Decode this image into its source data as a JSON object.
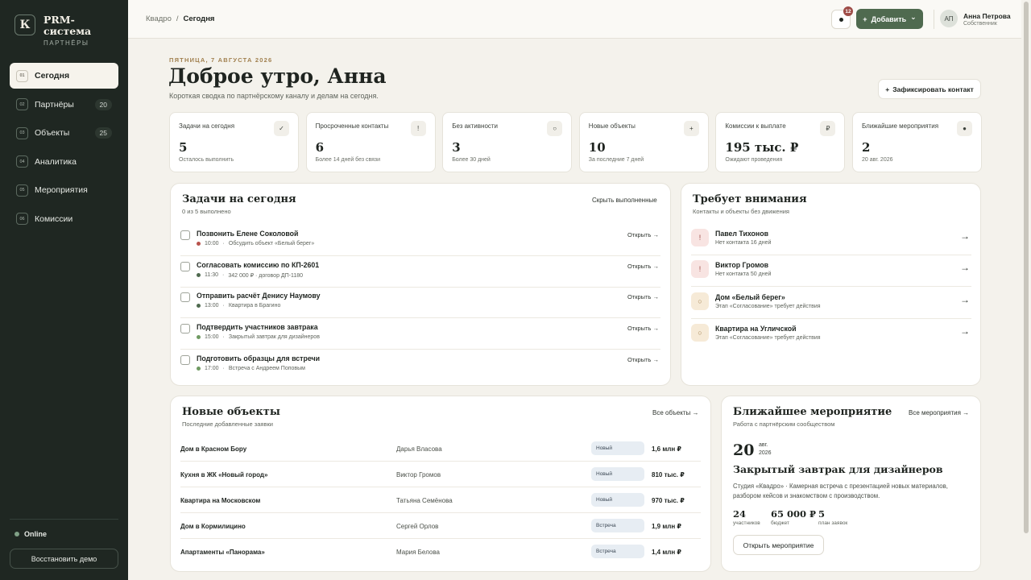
{
  "sidebar": {
    "brand_letter": "К",
    "brand_title": "PRM-система",
    "brand_sub": "ПАРТНЁРЫ",
    "items": [
      {
        "num": "01",
        "label": "Сегодня",
        "badge": ""
      },
      {
        "num": "02",
        "label": "Партнёры",
        "badge": "20"
      },
      {
        "num": "03",
        "label": "Объекты",
        "badge": "25"
      },
      {
        "num": "04",
        "label": "Аналитика",
        "badge": ""
      },
      {
        "num": "05",
        "label": "Мероприятия",
        "badge": ""
      },
      {
        "num": "06",
        "label": "Комиссии",
        "badge": ""
      }
    ],
    "online": "Online",
    "restore": "Восстановить демо"
  },
  "topbar": {
    "crumb_root": "Квадро",
    "crumb_sep": "/",
    "crumb_current": "Сегодня",
    "notif_count": "12",
    "add_label": "Добавить",
    "add_plus": "+",
    "add_chevron": "⌄",
    "user_initials": "АП",
    "user_name": "Анна Петрова",
    "user_role": "Собственник"
  },
  "header": {
    "date": "ПЯТНИЦА, 7 АВГУСТА 2026",
    "greeting": "Доброе утро, Анна",
    "subtitle": "Короткая сводка по партнёрскому каналу и делам на сегодня.",
    "fix_button": "Зафиксировать контакт",
    "fix_plus": "+"
  },
  "kpis": [
    {
      "label": "Задачи на сегодня",
      "icon": "✓",
      "value": "5",
      "note": "Осталось выполнить"
    },
    {
      "label": "Просроченные контакты",
      "icon": "!",
      "value": "6",
      "note": "Более 14 дней без связи"
    },
    {
      "label": "Без активности",
      "icon": "○",
      "value": "3",
      "note": "Более 30 дней"
    },
    {
      "label": "Новые объекты",
      "icon": "+",
      "value": "10",
      "note": "За последние 7 дней"
    },
    {
      "label": "Комиссии к выплате",
      "icon": "₽",
      "value": "195 тыс. ₽",
      "note": "Ожидают проведения"
    },
    {
      "label": "Ближайшие мероприятия",
      "icon": "●",
      "value": "2",
      "note": "20 авг. 2026"
    }
  ],
  "tasks": {
    "title": "Задачи на сегодня",
    "sub": "0 из 5 выполнено",
    "hide_link": "Скрыть выполненные",
    "open_label": "Открыть →",
    "items": [
      {
        "title": "Позвонить Елене Соколовой",
        "time": "10:00",
        "sep": "·",
        "desc": "Обсудить объект «Белый берег»",
        "dot": "#b8534c"
      },
      {
        "title": "Согласовать комиссию по КП-2601",
        "time": "11:30",
        "sep": "·",
        "desc": "342 000 ₽ · договор ДП-1180",
        "dot": "#4f6a4f"
      },
      {
        "title": "Отправить расчёт Денису Наумову",
        "time": "13:00",
        "sep": "·",
        "desc": "Квартира в Брагино",
        "dot": "#4f6a4f"
      },
      {
        "title": "Подтвердить участников завтрака",
        "time": "15:00",
        "sep": "·",
        "desc": "Закрытый завтрак для дизайнеров",
        "dot": "#6f9a62"
      },
      {
        "title": "Подготовить образцы для встречи",
        "time": "17:00",
        "sep": "·",
        "desc": "Встреча с Андреем Поповым",
        "dot": "#6f9a62"
      }
    ]
  },
  "attention": {
    "title": "Требует внимания",
    "sub": "Контакты и объекты без движения",
    "items": [
      {
        "icon": "!",
        "title": "Павел Тихонов",
        "sub": "Нет контакта 16 дней",
        "bg": "#f8e4e2",
        "fg": "#9e4b46"
      },
      {
        "icon": "!",
        "title": "Виктор Громов",
        "sub": "Нет контакта 50 дней",
        "bg": "#f8e4e2",
        "fg": "#9e4b46"
      },
      {
        "icon": "○",
        "title": "Дом «Белый берег»",
        "sub": "Этап «Согласование» требует действия",
        "bg": "#f6ead7",
        "fg": "#a1804f"
      },
      {
        "icon": "○",
        "title": "Квартира на Угличской",
        "sub": "Этап «Согласование» требует действия",
        "bg": "#f6ead7",
        "fg": "#a1804f"
      }
    ],
    "arrow": "→"
  },
  "objects": {
    "title": "Новые объекты",
    "sub": "Последние добавленные заявки",
    "all_link": "Все объекты →",
    "rows": [
      {
        "name": "Дом в Красном Бору",
        "person": "Дарья Власова",
        "status": "Новый",
        "price": "1,6 млн ₽"
      },
      {
        "name": "Кухня в ЖК «Новый город»",
        "person": "Виктор Громов",
        "status": "Новый",
        "price": "810 тыс. ₽"
      },
      {
        "name": "Квартира на Московском",
        "person": "Татьяна Семёнова",
        "status": "Новый",
        "price": "970 тыс. ₽"
      },
      {
        "name": "Дом в Кормилицино",
        "person": "Сергей Орлов",
        "status": "Встреча",
        "price": "1,9 млн ₽"
      },
      {
        "name": "Апартаменты «Панорама»",
        "person": "Мария Белова",
        "status": "Встреча",
        "price": "1,4 млн ₽"
      }
    ]
  },
  "event": {
    "title": "Ближайшее мероприятие",
    "sub": "Работа с партнёрским сообществом",
    "all_link": "Все мероприятия →",
    "day": "20",
    "month": "авг.",
    "year": "2026",
    "name": "Закрытый завтрак для дизайнеров",
    "desc": "Студия «Квадро» · Камерная встреча с презентацией новых материалов, разбором кейсов и знакомством с производством.",
    "stats": [
      {
        "value": "24",
        "label": "участников"
      },
      {
        "value": "65 000 ₽",
        "label": "бюджет"
      },
      {
        "value": "5",
        "label": "план заявок"
      }
    ],
    "button": "Открыть мероприятие"
  }
}
